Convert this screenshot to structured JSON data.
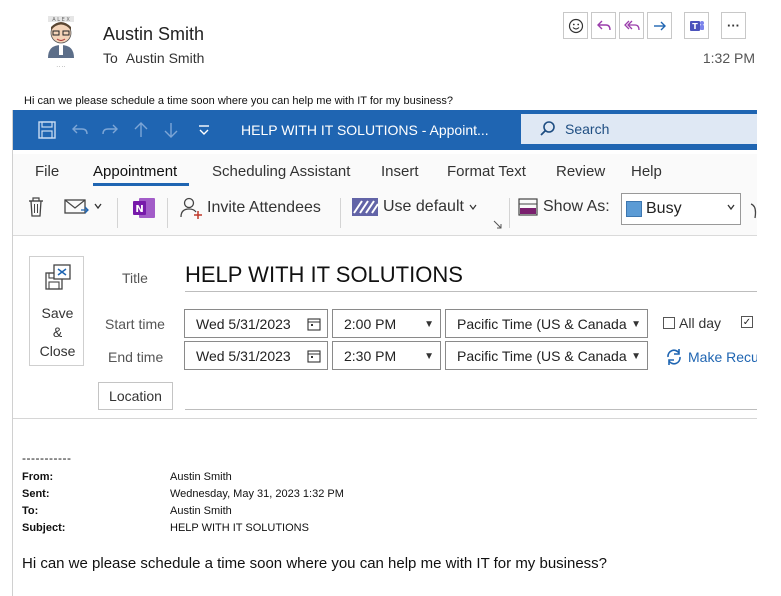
{
  "email": {
    "sender": "Austin Smith",
    "to_label": "To",
    "recipient": "Austin Smith",
    "time": "1:32 PM",
    "preview": "Hi can we please schedule a time soon where you can help me with IT for my business?"
  },
  "actions": [
    "emoji-icon",
    "reply-icon",
    "reply-all-icon",
    "forward-icon",
    "teams-icon",
    "more-icon"
  ],
  "actions_more_label": "···",
  "window": {
    "title": "HELP WITH IT SOLUTIONS  -  Appoint...",
    "search_label": "Search"
  },
  "tabs": [
    "File",
    "Appointment",
    "Scheduling Assistant",
    "Insert",
    "Format Text",
    "Review",
    "Help"
  ],
  "ribbon": {
    "invite_label": "Invite Attendees",
    "use_default_label": "Use default",
    "show_as_label": "Show As:",
    "busy_value": "Busy"
  },
  "form": {
    "save_label_1": "Save",
    "save_label_2": "&",
    "save_label_3": "Close",
    "title_label": "Title",
    "title_value": "HELP WITH IT SOLUTIONS",
    "start_label": "Start time",
    "end_label": "End time",
    "start_date": "Wed 5/31/2023",
    "start_time": "2:00 PM",
    "end_date": "Wed 5/31/2023",
    "end_time": "2:30 PM",
    "timezone": "Pacific Time (US & Canada",
    "allday_label": "All day",
    "recur_label": "Make Recurr",
    "location_label": "Location"
  },
  "forwarded": {
    "dashes": "-----------",
    "from_key": "From:",
    "from_val": "Austin Smith",
    "sent_key": "Sent:",
    "sent_val": "Wednesday, May 31, 2023 1:32 PM",
    "to_key": "To:",
    "to_val": "Austin Smith",
    "subject_key": "Subject:",
    "subject_val": "HELP WITH IT SOLUTIONS",
    "body": "Hi can we please schedule a time soon where you can help me with IT for my business?"
  },
  "colors": {
    "accent": "#1f65b2",
    "teams": "#4b53bc",
    "onenote": "#7719aa",
    "busy_swatch": "#5b9bd5"
  }
}
